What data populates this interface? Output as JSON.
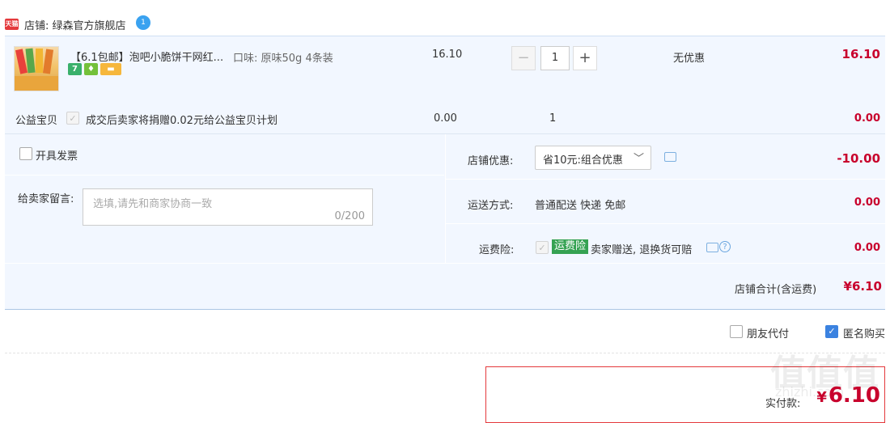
{
  "shop": {
    "logo_text": "天猫",
    "label": "店铺: 绿森官方旗舰店",
    "ww_badge": "1"
  },
  "item": {
    "title": "【6.1包邮】泡吧小脆饼干网红...",
    "sku": "口味: 原味50g 4条装",
    "unit_price": "16.10",
    "quantity": "1",
    "discount": "无优惠",
    "subtotal": "16.10",
    "badges": [
      {
        "name": "seven-day-return-badge",
        "text": "7"
      },
      {
        "name": "guarantee-badge",
        "text": "♦"
      },
      {
        "name": "card-pay-badge",
        "text": "▬"
      }
    ]
  },
  "charity": {
    "label": "公益宝贝",
    "text": "成交后卖家将捐赠0.02元给公益宝贝计划",
    "price": "0.00",
    "quantity": "1",
    "total": "0.00"
  },
  "options": {
    "invoice_label": "开具发票",
    "message_label": "给卖家留言:",
    "message_placeholder": "选填,请先和商家协商一致",
    "message_count": "0/200",
    "promo_label": "店铺优惠:",
    "promo_value": "省10元:组合优惠",
    "promo_amount": "-10.00",
    "shipping_label": "运送方式:",
    "shipping_value": "普通配送 快递 免邮",
    "shipping_amount": "0.00",
    "insurance_label": "运费险:",
    "insurance_tag": "运费险",
    "insurance_text": "卖家赠送, 退换货可赔",
    "insurance_amount": "0.00"
  },
  "shop_total": {
    "label": "店铺合计(含运费)",
    "amount": "¥6.10"
  },
  "footer": {
    "friend_pay_label": "朋友代付",
    "anonymous_label": "匿名购买",
    "anonymous_checked": true,
    "pay_label": "实付款:",
    "pay_currency": "¥",
    "pay_amount": "6.10"
  },
  "watermark": {
    "main": "值值值",
    "sub": "zhizhi.com"
  },
  "colors": {
    "price_red": "#c8002c",
    "panel_blue": "#f2f7ff",
    "accent_blue": "#3b82e0",
    "insurance_green": "#35a252"
  }
}
